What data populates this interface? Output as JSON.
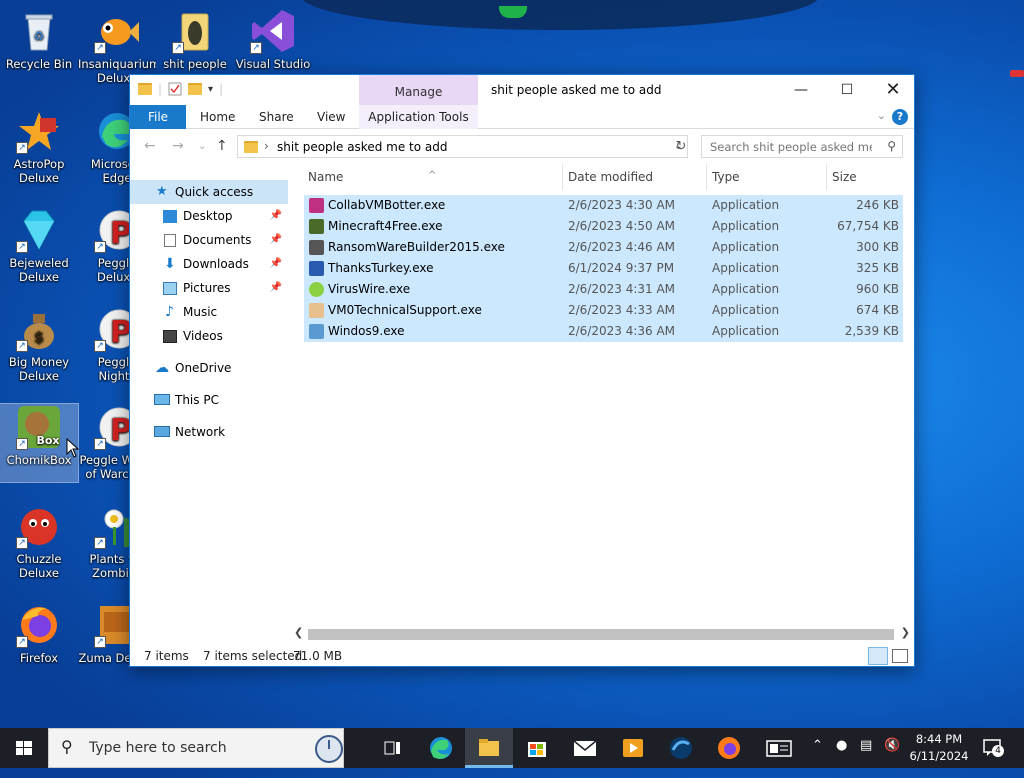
{
  "desktop": {
    "icons": [
      {
        "label": "Recycle Bin"
      },
      {
        "label": "Insaniquarium Deluxe"
      },
      {
        "label": "shit people"
      },
      {
        "label": "Visual Studio"
      },
      {
        "label": "AstroPop Deluxe"
      },
      {
        "label": "Microsoft Edge"
      },
      {
        "label": "Bejeweled Deluxe"
      },
      {
        "label": "Peggle Deluxe"
      },
      {
        "label": "Big Money Deluxe"
      },
      {
        "label": "Peggle Nights Deluxe"
      },
      {
        "label": "ChomikBox"
      },
      {
        "label": "Peggle World of Warcraft"
      },
      {
        "label": "Chuzzle Deluxe"
      },
      {
        "label": "Plants vs. Zombies"
      },
      {
        "label": "Firefox"
      },
      {
        "label": "Zuma Deluxe"
      }
    ]
  },
  "window": {
    "title": "shit people asked me to add",
    "manage_label": "Manage",
    "ribbon": {
      "file": "File",
      "home": "Home",
      "share": "Share",
      "view": "View",
      "app_tools": "Application Tools"
    },
    "address": "shit people asked me to add",
    "search_placeholder": "Search shit people asked me t...",
    "nav": {
      "quick_access": "Quick access",
      "desktop": "Desktop",
      "documents": "Documents",
      "downloads": "Downloads",
      "pictures": "Pictures",
      "music": "Music",
      "videos": "Videos",
      "onedrive": "OneDrive",
      "this_pc": "This PC",
      "network": "Network"
    },
    "columns": {
      "name": "Name",
      "date": "Date modified",
      "type": "Type",
      "size": "Size"
    },
    "files": [
      {
        "name": "CollabVMBotter.exe",
        "date": "2/6/2023 4:30 AM",
        "type": "Application",
        "size": "246 KB"
      },
      {
        "name": "Minecraft4Free.exe",
        "date": "2/6/2023 4:50 AM",
        "type": "Application",
        "size": "67,754 KB"
      },
      {
        "name": "RansomWareBuilder2015.exe",
        "date": "2/6/2023 4:46 AM",
        "type": "Application",
        "size": "300 KB"
      },
      {
        "name": "ThanksTurkey.exe",
        "date": "6/1/2024 9:37 PM",
        "type": "Application",
        "size": "325 KB"
      },
      {
        "name": "VirusWire.exe",
        "date": "2/6/2023 4:31 AM",
        "type": "Application",
        "size": "960 KB"
      },
      {
        "name": "VM0TechnicalSupport.exe",
        "date": "2/6/2023 4:33 AM",
        "type": "Application",
        "size": "674 KB"
      },
      {
        "name": "Windos9.exe",
        "date": "2/6/2023 4:36 AM",
        "type": "Application",
        "size": "2,539 KB"
      }
    ],
    "status": {
      "count": "7 items",
      "selected": "7 items selected",
      "size": "71.0 MB"
    }
  },
  "taskbar": {
    "search_placeholder": "Type here to search",
    "time": "8:44 PM",
    "date": "6/11/2024",
    "notifications": "4"
  },
  "colors": {
    "accent": "#1979ca",
    "selection": "#cce8ff",
    "taskbar": "#1c1f26",
    "manage_tab": "#e9d8f5"
  }
}
